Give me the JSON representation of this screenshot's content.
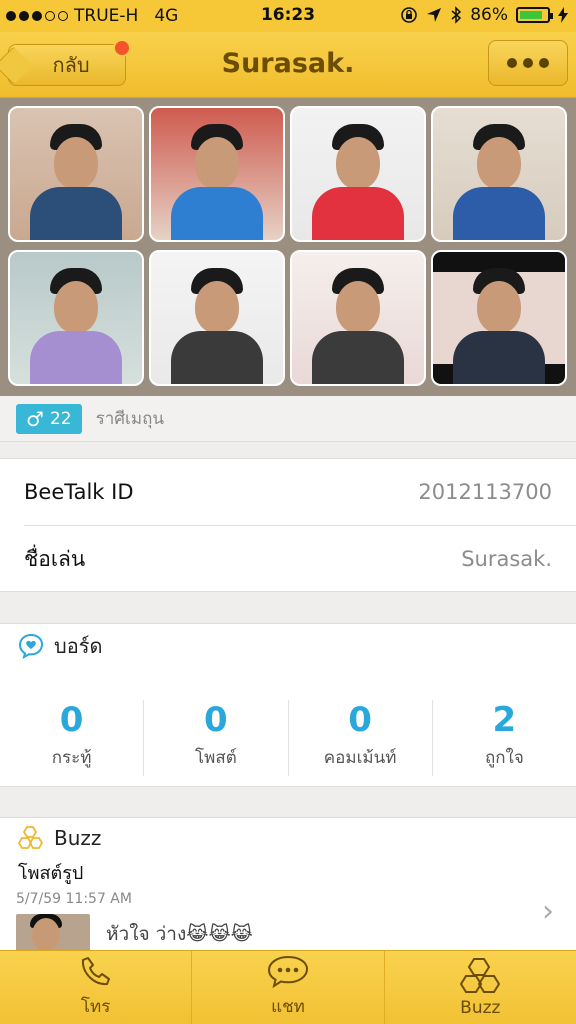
{
  "status_bar": {
    "carrier": "TRUE-H",
    "network": "4G",
    "time": "16:23",
    "battery": "86%",
    "battery_level": 0.86
  },
  "nav": {
    "back_label": "กลับ",
    "title": "Surasak."
  },
  "profile": {
    "age": "22",
    "gender_symbol": "♂",
    "zodiac": "ราศีเมถุน",
    "photo_count": 8
  },
  "details": {
    "rows": [
      {
        "label": "BeeTalk ID",
        "value": "2012113700"
      },
      {
        "label": "ชื่อเล่น",
        "value": "Surasak."
      }
    ]
  },
  "board": {
    "title": "บอร์ด",
    "stats": [
      {
        "value": "0",
        "label": "กระทู้"
      },
      {
        "value": "0",
        "label": "โพสต์"
      },
      {
        "value": "0",
        "label": "คอมเม้นท์"
      },
      {
        "value": "2",
        "label": "ถูกใจ"
      }
    ]
  },
  "buzz": {
    "title": "Buzz",
    "post_type": "โพสต์รูป",
    "timestamp": "5/7/59 11:57 AM",
    "text": "หัวใจ ว่าง😹😹😹"
  },
  "tabs": [
    {
      "label": "โทร",
      "icon": "phone-icon"
    },
    {
      "label": "แชท",
      "icon": "chat-bubble-icon"
    },
    {
      "label": "Buzz",
      "icon": "honeycomb-icon"
    }
  ],
  "colors": {
    "accent_yellow": "#f6c837",
    "stat_blue": "#2aa8dc",
    "gender_badge": "#38b7d6",
    "notification_red": "#f4542b"
  }
}
